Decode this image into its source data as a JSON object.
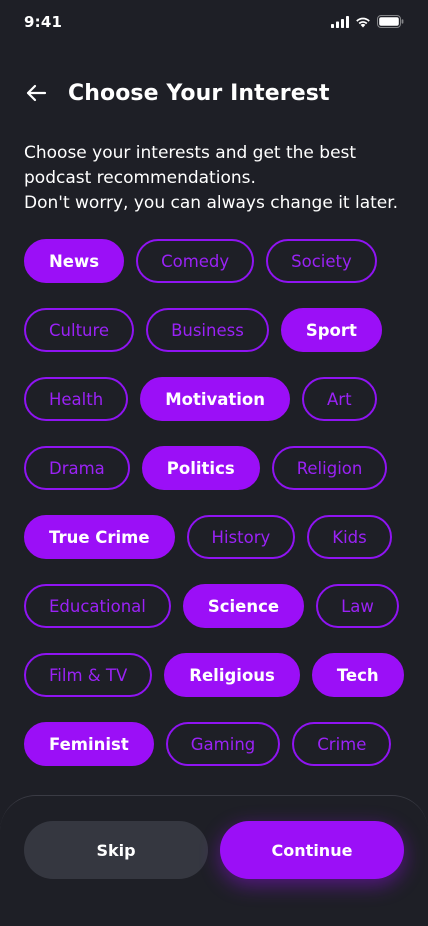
{
  "status_bar": {
    "time": "9:41"
  },
  "header": {
    "title": "Choose Your Interest"
  },
  "description": {
    "line1": "Choose your interests and get the best",
    "line2": "podcast recommendations.",
    "line3": "Don't worry, you can always change it later."
  },
  "interests": [
    {
      "label": "News",
      "selected": true
    },
    {
      "label": "Comedy",
      "selected": false
    },
    {
      "label": "Society",
      "selected": false
    },
    {
      "label": "Culture",
      "selected": false
    },
    {
      "label": "Business",
      "selected": false
    },
    {
      "label": "Sport",
      "selected": true
    },
    {
      "label": "Health",
      "selected": false
    },
    {
      "label": "Motivation",
      "selected": true
    },
    {
      "label": "Art",
      "selected": false
    },
    {
      "label": "Drama",
      "selected": false
    },
    {
      "label": "Politics",
      "selected": true
    },
    {
      "label": "Religion",
      "selected": false
    },
    {
      "label": "True Crime",
      "selected": true
    },
    {
      "label": "History",
      "selected": false
    },
    {
      "label": "Kids",
      "selected": false
    },
    {
      "label": "Educational",
      "selected": false
    },
    {
      "label": "Science",
      "selected": true
    },
    {
      "label": "Law",
      "selected": false
    },
    {
      "label": "Film & TV",
      "selected": false
    },
    {
      "label": "Religious",
      "selected": true
    },
    {
      "label": "Tech",
      "selected": true
    },
    {
      "label": "Feminist",
      "selected": true
    },
    {
      "label": "Gaming",
      "selected": false
    },
    {
      "label": "Crime",
      "selected": false
    }
  ],
  "actions": {
    "skip_label": "Skip",
    "continue_label": "Continue"
  },
  "colors": {
    "background": "#1e1f26",
    "accent": "#9b0ff7",
    "secondary_button": "#353740"
  }
}
